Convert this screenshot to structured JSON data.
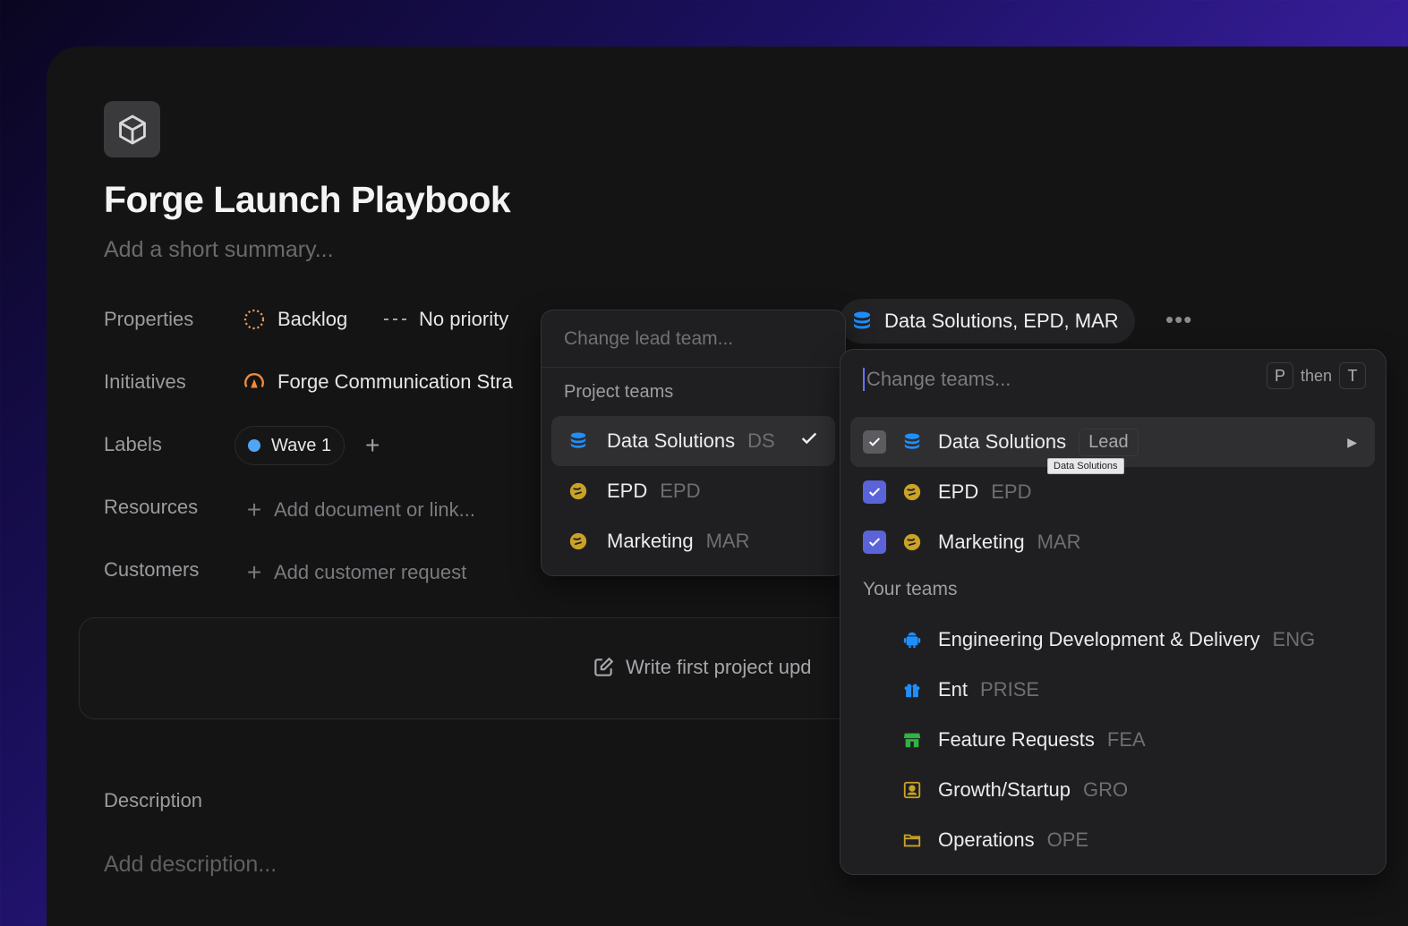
{
  "project": {
    "title": "Forge Launch Playbook",
    "summary_placeholder": "Add a short summary..."
  },
  "properties": {
    "label": "Properties",
    "status": "Backlog",
    "priority": "No priority",
    "teams_chip": "Data Solutions, EPD, MAR"
  },
  "initiatives": {
    "label": "Initiatives",
    "value": "Forge Communication Stra"
  },
  "labels": {
    "label": "Labels",
    "chip": "Wave 1"
  },
  "resources": {
    "label": "Resources",
    "placeholder": "Add document or link..."
  },
  "customers": {
    "label": "Customers",
    "placeholder": "Add customer request"
  },
  "update": {
    "text": "Write first project upd"
  },
  "description": {
    "label": "Description",
    "placeholder": "Add description..."
  },
  "lead_popover": {
    "search_placeholder": "Change lead team...",
    "group": "Project teams",
    "options": [
      {
        "name": "Data Solutions",
        "code": "DS",
        "icon": "database-icon",
        "selected": true
      },
      {
        "name": "EPD",
        "code": "EPD",
        "icon": "planet-icon",
        "selected": false
      },
      {
        "name": "Marketing",
        "code": "MAR",
        "icon": "planet-icon",
        "selected": false
      }
    ]
  },
  "teams_popover": {
    "search_placeholder": "Change teams...",
    "shortcut": {
      "key1": "P",
      "then": "then",
      "key2": "T"
    },
    "selected": [
      {
        "name": "Data Solutions",
        "badge": "Lead",
        "icon": "database-icon"
      },
      {
        "name": "EPD",
        "code": "EPD",
        "icon": "planet-icon"
      },
      {
        "name": "Marketing",
        "code": "MAR",
        "icon": "planet-icon"
      }
    ],
    "tooltip": "Data Solutions",
    "your_teams_label": "Your teams",
    "your_teams": [
      {
        "name": "Engineering Development & Delivery",
        "code": "ENG",
        "icon": "robot-icon"
      },
      {
        "name": "Ent",
        "code": "PRISE",
        "icon": "gift-icon"
      },
      {
        "name": "Feature Requests",
        "code": "FEA",
        "icon": "storefront-icon"
      },
      {
        "name": "Growth/Startup",
        "code": "GRO",
        "icon": "id-card-icon"
      },
      {
        "name": "Operations",
        "code": "OPE",
        "icon": "folder-icon"
      }
    ]
  },
  "colors": {
    "accent_blue": "#1f8fff",
    "planet_yellow": "#c9a227",
    "status_orange": "#f0a060",
    "green": "#2fb344",
    "checkbox_blue": "#5b63d9"
  }
}
